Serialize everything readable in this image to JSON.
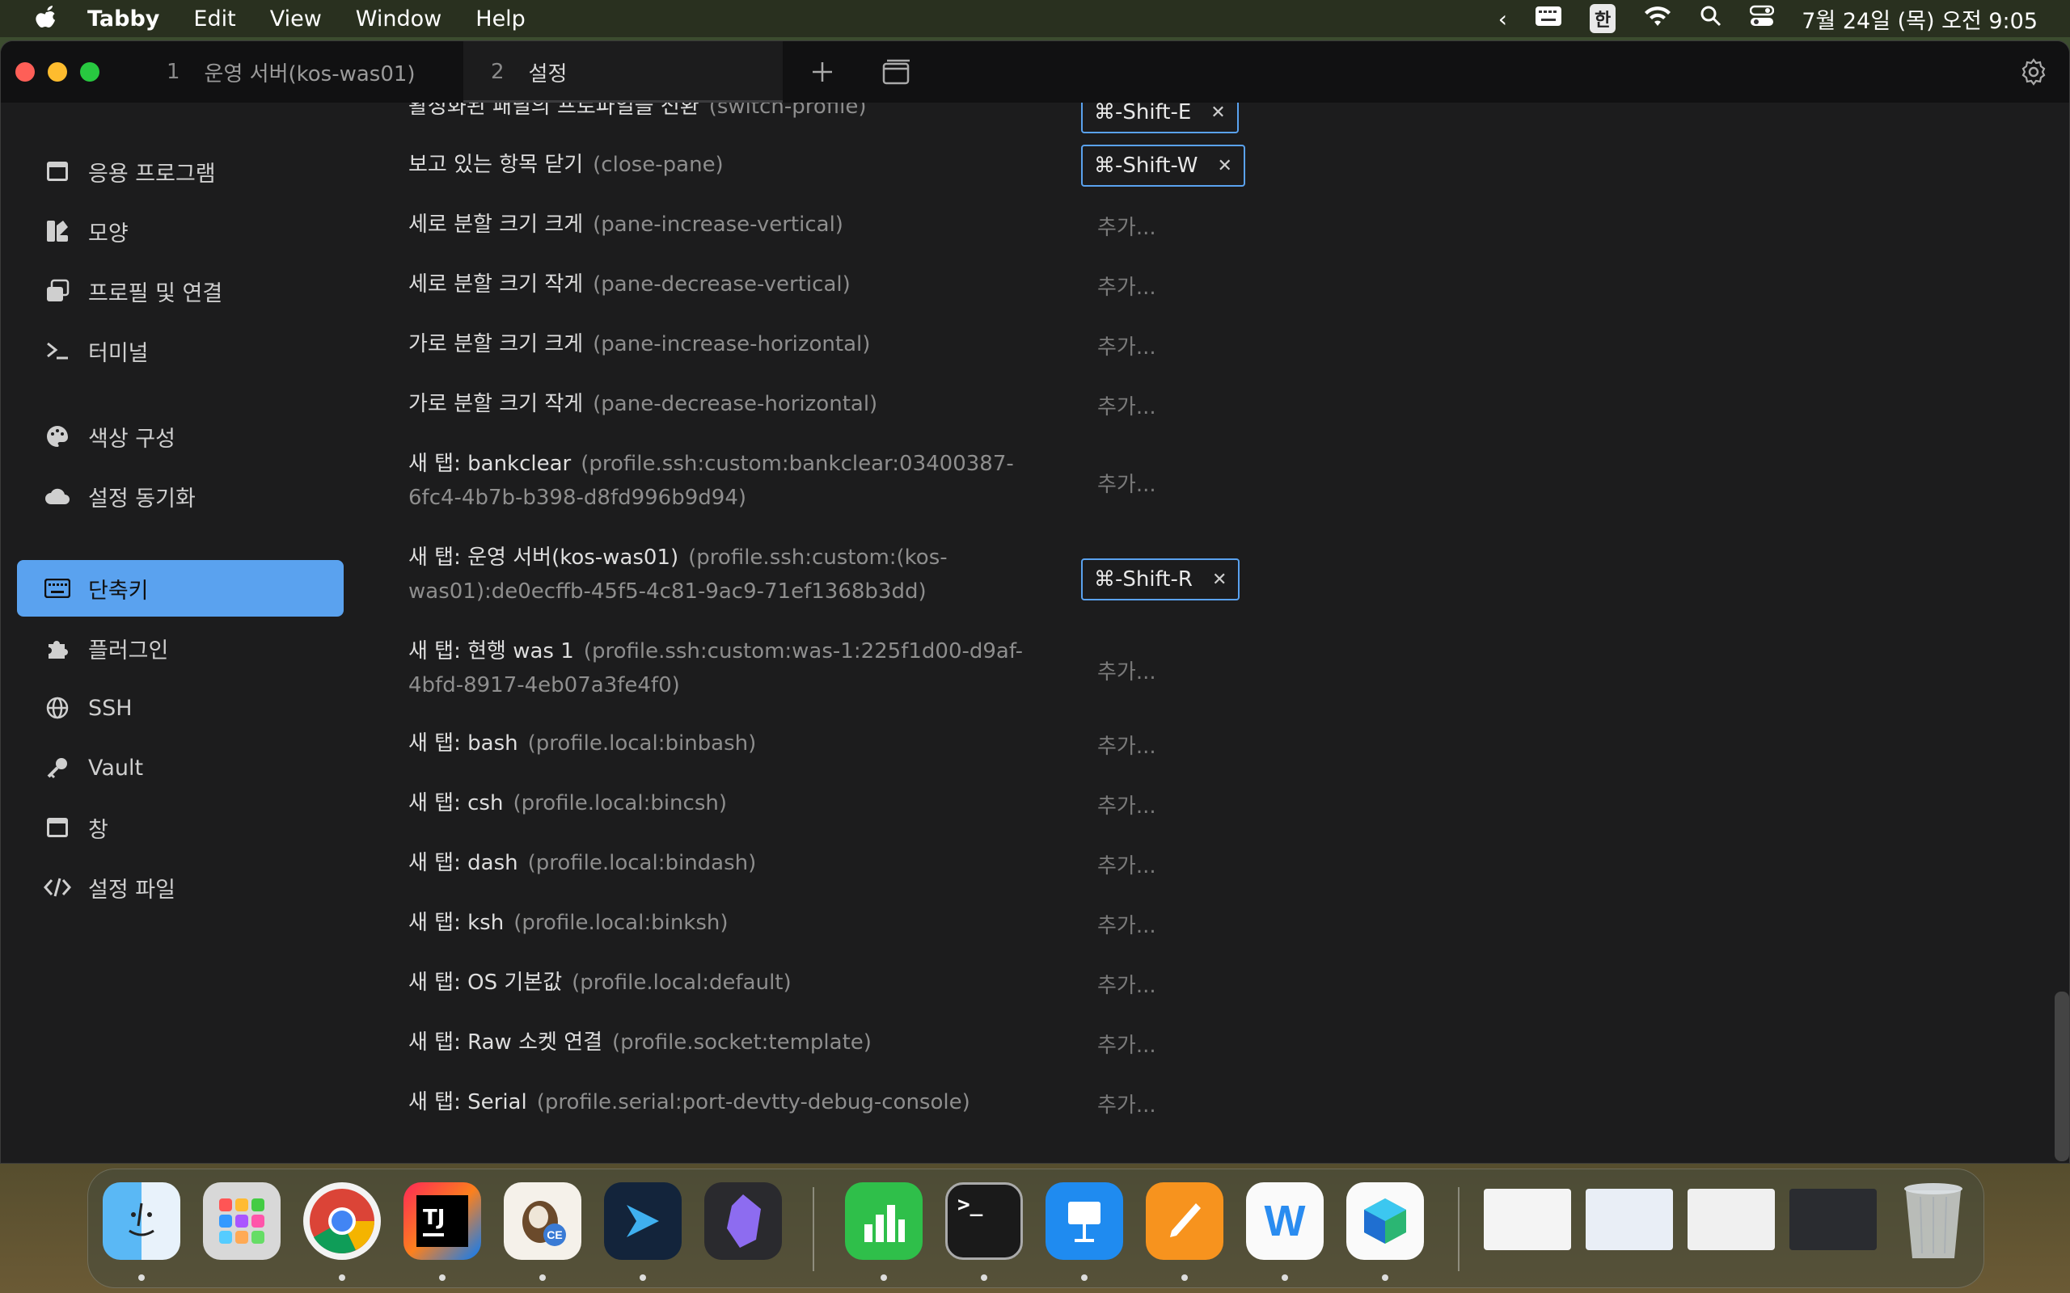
{
  "menubar": {
    "app": "Tabby",
    "items": [
      "Edit",
      "View",
      "Window",
      "Help"
    ],
    "input_source": "한",
    "datetime": "7월 24일 (목) 오전 9:05"
  },
  "tabs": [
    {
      "num": "1",
      "label": "운영 서버(kos-was01)"
    },
    {
      "num": "2",
      "label": "설정"
    }
  ],
  "sidebar": {
    "items": [
      {
        "label": "응용 프로그램",
        "icon": "window-icon"
      },
      {
        "label": "모양",
        "icon": "brush-icon"
      },
      {
        "label": "프로필 및 연결",
        "icon": "profiles-icon"
      },
      {
        "label": "터미널",
        "icon": "terminal-icon"
      },
      {
        "label": "색상 구성",
        "icon": "palette-icon"
      },
      {
        "label": "설정 동기화",
        "icon": "cloud-icon"
      },
      {
        "label": "단축키",
        "icon": "keyboard-icon",
        "active": true
      },
      {
        "label": "플러그인",
        "icon": "puzzle-icon"
      },
      {
        "label": "SSH",
        "icon": "globe-icon"
      },
      {
        "label": "Vault",
        "icon": "key-icon"
      },
      {
        "label": "창",
        "icon": "window-icon"
      },
      {
        "label": "설정 파일",
        "icon": "code-icon"
      }
    ]
  },
  "hotkeys": {
    "add_label": "추가...",
    "rows": [
      {
        "desc": "활성화된 패널의 프로파일을 전환",
        "id": "(switch-profile)",
        "binding": "⌘-Shift-E"
      },
      {
        "desc": "보고 있는 항목 닫기",
        "id": "(close-pane)",
        "binding": "⌘-Shift-W"
      },
      {
        "desc": "세로 분할 크기 크게",
        "id": "(pane-increase-vertical)",
        "binding": null
      },
      {
        "desc": "세로 분할 크기 작게",
        "id": "(pane-decrease-vertical)",
        "binding": null
      },
      {
        "desc": "가로 분할 크기 크게",
        "id": "(pane-increase-horizontal)",
        "binding": null
      },
      {
        "desc": "가로 분할 크기 작게",
        "id": "(pane-decrease-horizontal)",
        "binding": null
      },
      {
        "desc": "새 탭: bankclear",
        "id": "(profile.ssh:custom:bankclear:03400387-6fc4-4b7b-b398-d8fd996b9d94)",
        "binding": null
      },
      {
        "desc": "새 탭: 운영 서버(kos-was01)",
        "id": "(profile.ssh:custom:(kos-was01):de0ecffb-45f5-4c81-9ac9-71ef1368b3dd)",
        "binding": "⌘-Shift-R"
      },
      {
        "desc": "새 탭: 현행 was 1",
        "id": "(profile.ssh:custom:was-1:225f1d00-d9af-4bfd-8917-4eb07a3fe4f0)",
        "binding": null
      },
      {
        "desc": "새 탭: bash",
        "id": "(profile.local:binbash)",
        "binding": null
      },
      {
        "desc": "새 탭: csh",
        "id": "(profile.local:bincsh)",
        "binding": null
      },
      {
        "desc": "새 탭: dash",
        "id": "(profile.local:bindash)",
        "binding": null
      },
      {
        "desc": "새 탭: ksh",
        "id": "(profile.local:binksh)",
        "binding": null
      },
      {
        "desc": "새 탭: OS 기본값",
        "id": "(profile.local:default)",
        "binding": null
      },
      {
        "desc": "새 탭: Raw 소켓 연결",
        "id": "(profile.socket:template)",
        "binding": null
      },
      {
        "desc": "새 탭: Serial",
        "id": "(profile.serial:port-devtty-debug-console)",
        "binding": null
      }
    ]
  },
  "dock": {
    "apps": [
      "Finder",
      "Launchpad",
      "Chrome",
      "IntelliJ IDEA",
      "DBeaver CE",
      "Tabby",
      "Obsidian",
      "Numbers",
      "Terminal",
      "Keynote",
      "Pages",
      "Naver Whale",
      "Naver Works",
      "Trash"
    ]
  },
  "colors": {
    "accent": "#5aa2ef",
    "window_bg": "#1c1c1d",
    "titlebar_bg": "#111112"
  }
}
